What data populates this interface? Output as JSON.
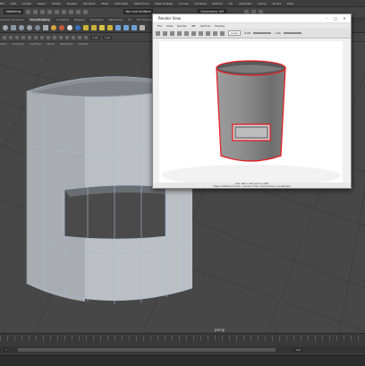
{
  "menubar": {
    "items": [
      "File",
      "Edit",
      "Create",
      "Select",
      "Modify",
      "Display",
      "Windows",
      "Mesh",
      "Edit Mesh",
      "Mesh Tools",
      "Mesh Display",
      "Curves",
      "Surfaces",
      "Deform",
      "UV",
      "Generate",
      "Cache",
      "Arnold",
      "Help"
    ]
  },
  "status_line": {
    "mode": "Modeling",
    "object_field": "No Live Surface",
    "symmetry": "Symmetry: Off"
  },
  "shelf": {
    "tabs": [
      "Curves / Surfaces",
      "Poly Modeling",
      "Sculpting",
      "Rigging",
      "Animation",
      "Rendering",
      "FX",
      "FX Caching",
      "Custom",
      "Arnold",
      "Bifrost",
      "MASH",
      "Motion Graphics",
      "XGen"
    ],
    "active_tab": "Poly Modeling"
  },
  "viewport": {
    "menu": [
      "View",
      "Shading",
      "Lighting",
      "Show",
      "Renderer",
      "Panels"
    ],
    "fields": [
      "0.00",
      "1.00"
    ],
    "camera_label": "persp"
  },
  "timeline": {
    "current_frame": "1"
  },
  "range_slider": {
    "start": "1",
    "end": "120"
  },
  "render_view": {
    "title": "Render View",
    "controls": [
      "–",
      "□",
      "✕"
    ],
    "menu": [
      "File",
      "View",
      "Render",
      "IPR",
      "Options",
      "Display"
    ],
    "camera_dropdown": "persp",
    "exposure": "0.00",
    "gamma": "1.00",
    "status_line1": "size: 960 x 540  zoom: 0.188",
    "status_line2": "(Maya Software)  Frame: 1  Render Time: 0:00  Camera: perspShape"
  },
  "colors": {
    "outline": "#e8181f",
    "viewport_bg": "#474747",
    "mesh": "#bfc2c6",
    "wire": "#9ab4d6"
  }
}
